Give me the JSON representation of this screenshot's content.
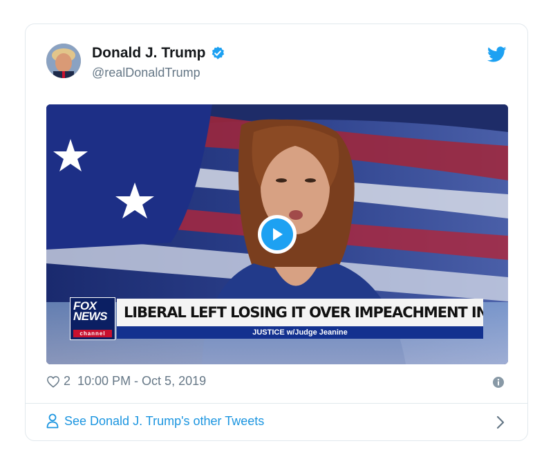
{
  "tweet": {
    "author_name": "Donald J. Trump",
    "author_handle": "@realDonaldTrump",
    "verified": true,
    "like_count": "2",
    "timestamp": "10:00 PM - Oct 5, 2019",
    "footer_link": "See Donald J. Trump's other Tweets"
  },
  "video": {
    "headline": "LIBERAL LEFT LOSING IT OVER IMPEACHMENT INQUIRY",
    "show_name": "JUSTICE w/Judge Jeanine",
    "network_logo_line1": "FOX",
    "network_logo_line2": "NEWS",
    "network_logo_channel": "channel"
  },
  "icons": {
    "verified": "verified-badge-icon",
    "brand": "twitter-bird-icon",
    "play": "play-icon",
    "like": "heart-icon",
    "info": "info-icon",
    "user": "person-icon",
    "chevron": "chevron-right-icon"
  },
  "colors": {
    "brand_blue": "#1da1f2",
    "link_blue": "#1b95e0",
    "muted_text": "#657786",
    "border": "#e1e8ed"
  }
}
